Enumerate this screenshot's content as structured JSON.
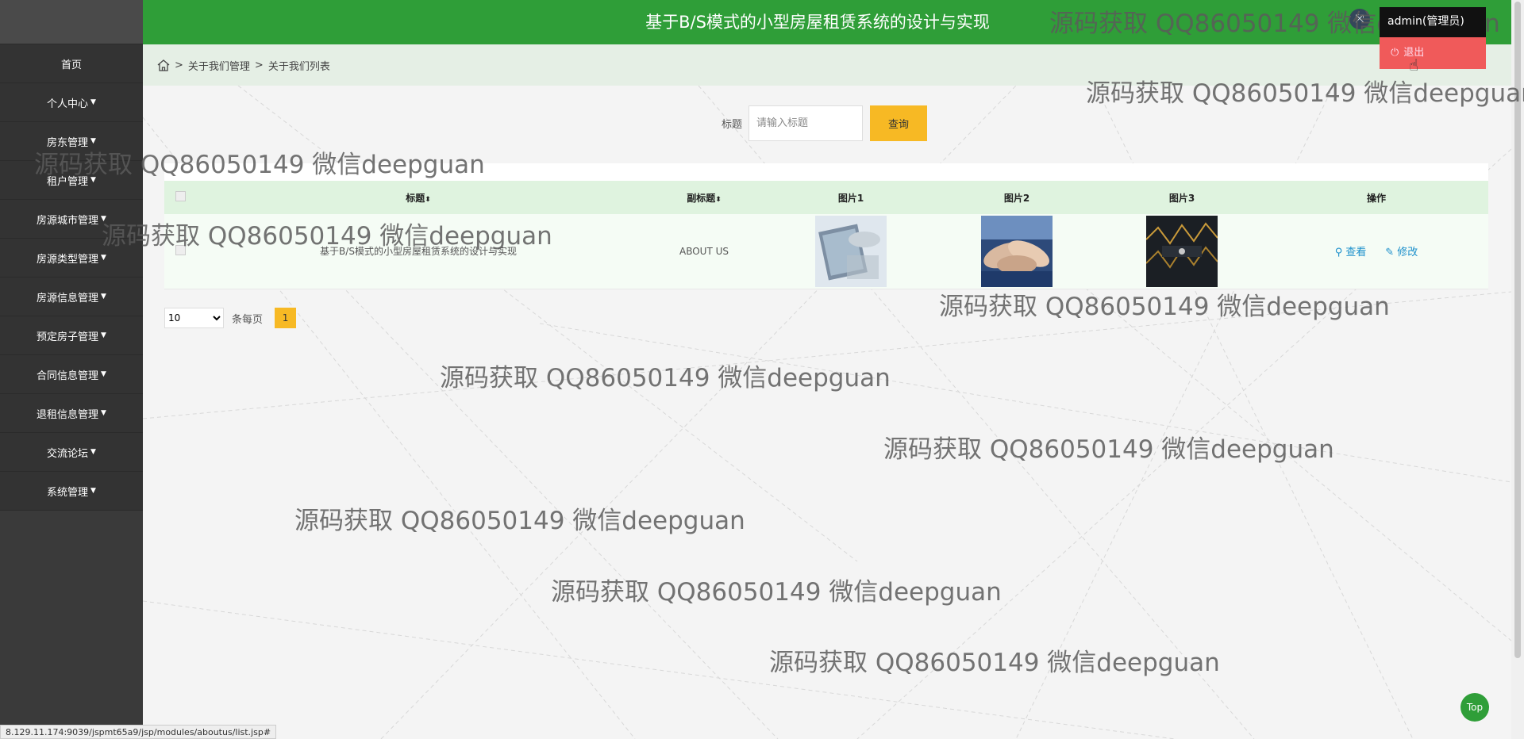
{
  "header": {
    "title": "基于B/S模式的小型房屋租赁系统的设计与实现",
    "fullscreen_icon": "fullscreen-icon",
    "user_label": "admin(管理员)",
    "logout_label": "退出"
  },
  "sidebar": {
    "items": [
      {
        "label": "首页",
        "caret": false
      },
      {
        "label": "个人中心",
        "caret": true
      },
      {
        "label": "房东管理",
        "caret": true
      },
      {
        "label": "租户管理",
        "caret": true
      },
      {
        "label": "房源城市管理",
        "caret": true
      },
      {
        "label": "房源类型管理",
        "caret": true
      },
      {
        "label": "房源信息管理",
        "caret": true
      },
      {
        "label": "预定房子管理",
        "caret": true
      },
      {
        "label": "合同信息管理",
        "caret": true
      },
      {
        "label": "退租信息管理",
        "caret": true
      },
      {
        "label": "交流论坛",
        "caret": true
      },
      {
        "label": "系统管理",
        "caret": true
      }
    ]
  },
  "breadcrumb": {
    "home_icon": "home-icon",
    "items": [
      "关于我们管理",
      "关于我们列表"
    ]
  },
  "search": {
    "label": "标题",
    "placeholder": "请输入标题",
    "button": "查询"
  },
  "table": {
    "headers": [
      "标题",
      "副标题",
      "图片1",
      "图片2",
      "图片3",
      "操作"
    ],
    "rows": [
      {
        "title": "基于B/S模式的小型房屋租赁系统的设计与实现",
        "subtitle": "ABOUT US"
      }
    ],
    "actions": {
      "view": "查看",
      "edit": "修改"
    }
  },
  "pagination": {
    "page_size": "10",
    "per_page_label": "条每页",
    "current_page": "1"
  },
  "watermark": "源码获取 QQ86050149 微信deepguan",
  "top_button": "Top",
  "status_url": "8.129.11.174:9039/jspmt65a9/jsp/modules/aboutus/list.jsp#",
  "colors": {
    "header_green": "#2f9e38",
    "sidebar_dark": "#333333",
    "accent_yellow": "#f7b924",
    "logout_red": "#f05a5a",
    "link_blue": "#1b8fcb"
  }
}
